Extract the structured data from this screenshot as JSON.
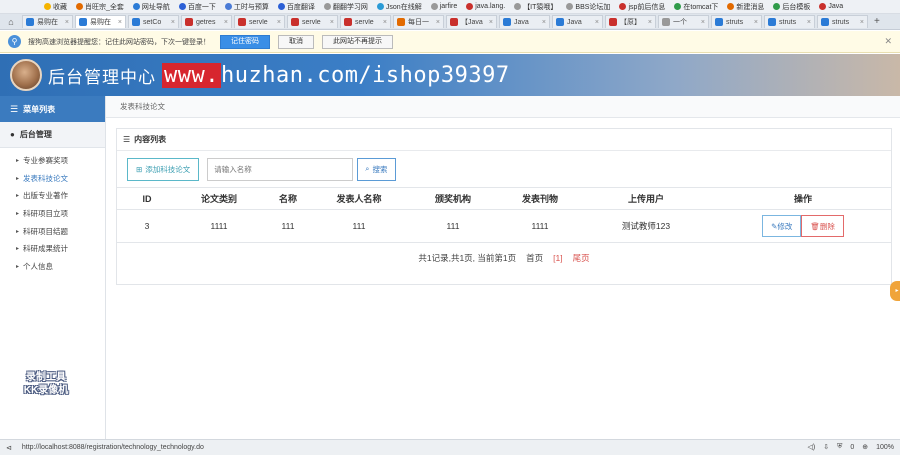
{
  "browser": {
    "bookmarks": [
      {
        "label": "收藏",
        "color": "#f5b400"
      },
      {
        "label": "肖旺宗_全套",
        "color": "#e26a00"
      },
      {
        "label": "网址导航",
        "color": "#2b7bd6"
      },
      {
        "label": "百度一下",
        "color": "#2b5fd6"
      },
      {
        "label": "工时与预算",
        "color": "#4a7bd6"
      },
      {
        "label": "百度翻译",
        "color": "#2b5fd6"
      },
      {
        "label": "翻翻学习网",
        "color": "#999999"
      },
      {
        "label": "Json在线解",
        "color": "#2b9bd6"
      },
      {
        "label": "jarfire",
        "color": "#999999"
      },
      {
        "label": "java.lang.",
        "color": "#c9302c"
      },
      {
        "label": "【IT猿哦】",
        "color": "#999999"
      },
      {
        "label": "BBS论坛加",
        "color": "#999999"
      },
      {
        "label": "jsp前后信息",
        "color": "#c9302c"
      },
      {
        "label": "在tomcat下",
        "color": "#2f9b4a"
      },
      {
        "label": "新建消息",
        "color": "#e26a00"
      },
      {
        "label": "后台模板",
        "color": "#2f9b4a"
      },
      {
        "label": "Java",
        "color": "#c9302c"
      }
    ],
    "tabs": [
      {
        "title": "易购在",
        "color": "#2b7bd6",
        "active": false
      },
      {
        "title": "易购在",
        "color": "#2b7bd6",
        "active": true
      },
      {
        "title": "setCo",
        "color": "#2b7bd6",
        "active": false
      },
      {
        "title": "getres",
        "color": "#c9302c",
        "active": false
      },
      {
        "title": "servle",
        "color": "#c9302c",
        "active": false
      },
      {
        "title": "servle",
        "color": "#c9302c",
        "active": false
      },
      {
        "title": "servle",
        "color": "#c9302c",
        "active": false
      },
      {
        "title": "每日一",
        "color": "#e26a00",
        "active": false
      },
      {
        "title": "【Java",
        "color": "#c9302c",
        "active": false
      },
      {
        "title": "Java",
        "color": "#2b7bd6",
        "active": false
      },
      {
        "title": "Java",
        "color": "#2b7bd6",
        "active": false
      },
      {
        "title": "【原】",
        "color": "#c9302c",
        "active": false
      },
      {
        "title": "一个",
        "color": "#999999",
        "active": false
      },
      {
        "title": "struts",
        "color": "#2b7bd6",
        "active": false
      },
      {
        "title": "struts",
        "color": "#2b7bd6",
        "active": false
      },
      {
        "title": "struts",
        "color": "#2b7bd6",
        "active": false
      }
    ],
    "infobar": {
      "message": "搜狗高速浏览器提醒您：记住此网站密码，下次一键登录！",
      "remember_label": "记住密码",
      "cancel_label": "取消",
      "never_label": "此网站不再提示"
    },
    "status": {
      "url": "http://localhost:8088/registration/technology_technology.do",
      "badge_count": "0",
      "zoom": "100%"
    }
  },
  "header": {
    "title": "后台管理中心",
    "watermark_prefix": "www.",
    "watermark_rest": "huzhan.com/ishop39397"
  },
  "sidebar": {
    "menu_title": "菜单列表",
    "group_title": "后台管理",
    "items": [
      {
        "label": "专业参赛奖项"
      },
      {
        "label": "发表科技论文"
      },
      {
        "label": "出版专业著作"
      },
      {
        "label": "科研项目立项"
      },
      {
        "label": "科研项目结题"
      },
      {
        "label": "科研成果统计"
      },
      {
        "label": "个人信息"
      }
    ],
    "tool_watermark_1": "录制工具",
    "tool_watermark_2": "KK录像机"
  },
  "main": {
    "breadcrumb": "发表科技论文",
    "panel_title": "内容列表",
    "add_label": "添加科技论文",
    "search_placeholder": "请输入名称",
    "search_label": "搜索",
    "columns": [
      "ID",
      "论文类别",
      "名称",
      "发表人名称",
      "颁奖机构",
      "发表刊物",
      "上传用户",
      "操作"
    ],
    "rows": [
      {
        "id": "3",
        "category": "1111",
        "name": "111",
        "author": "111",
        "org": "111",
        "journal": "1111",
        "uploader": "测试教师123"
      }
    ],
    "edit_label": "修改",
    "delete_label": "删除",
    "pager": {
      "summary": "共1记录,共1页, 当前第1页",
      "first": "首页",
      "current": "[1]",
      "last": "尾页"
    }
  }
}
